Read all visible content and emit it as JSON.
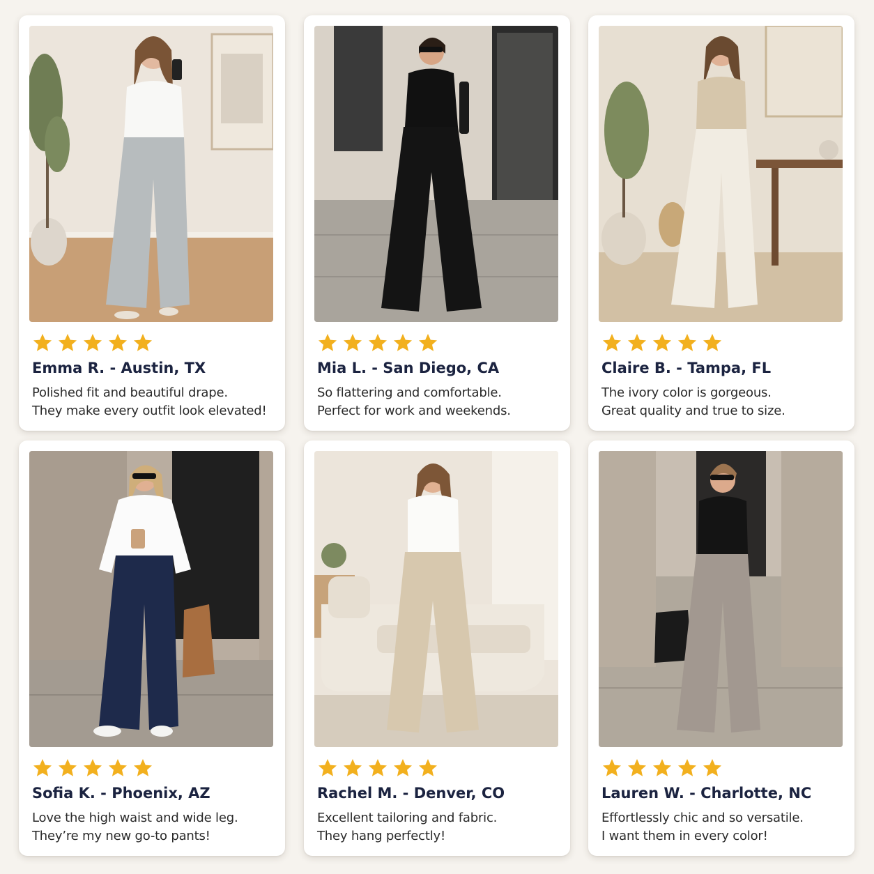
{
  "colors": {
    "background": "#f6f3ee",
    "card": "#ffffff",
    "star": "#f2b01e",
    "name_text": "#1b2340",
    "body_text": "#2a2a2a"
  },
  "reviews": [
    {
      "rating": 5,
      "photo": "woman-gray-wide-leg-pants-mirror-selfie",
      "name": "Emma R. - Austin, TX",
      "line1": "Polished fit and beautiful drape.",
      "line2": "They make every outfit look elevated!"
    },
    {
      "rating": 5,
      "photo": "woman-black-wide-leg-pants-street",
      "name": "Mia L. - San Diego, CA",
      "line1": "So flattering and comfortable.",
      "line2": "Perfect for work and weekends."
    },
    {
      "rating": 5,
      "photo": "woman-ivory-wide-leg-pants-interior",
      "name": "Claire B. - Tampa, FL",
      "line1": "The ivory color is gorgeous.",
      "line2": "Great quality and true to size."
    },
    {
      "rating": 5,
      "photo": "woman-navy-wide-leg-pants-street",
      "name": "Sofia  K.  - Phoenix, AZ",
      "line1": "Love the high waist and wide leg.",
      "line2": "They’re my new go-to pants!"
    },
    {
      "rating": 5,
      "photo": "woman-beige-wide-leg-pants-living-room",
      "name": "Rachel M. - Denver, CO",
      "line1": "Excellent tailoring and fabric.",
      "line2": "They hang perfectly!"
    },
    {
      "rating": 5,
      "photo": "woman-taupe-wide-leg-pants-street",
      "name": "Lauren W. - Charlotte, NC",
      "line1": "Effortlessly chic and so versatile.",
      "line2": "I want them in every color!"
    }
  ]
}
